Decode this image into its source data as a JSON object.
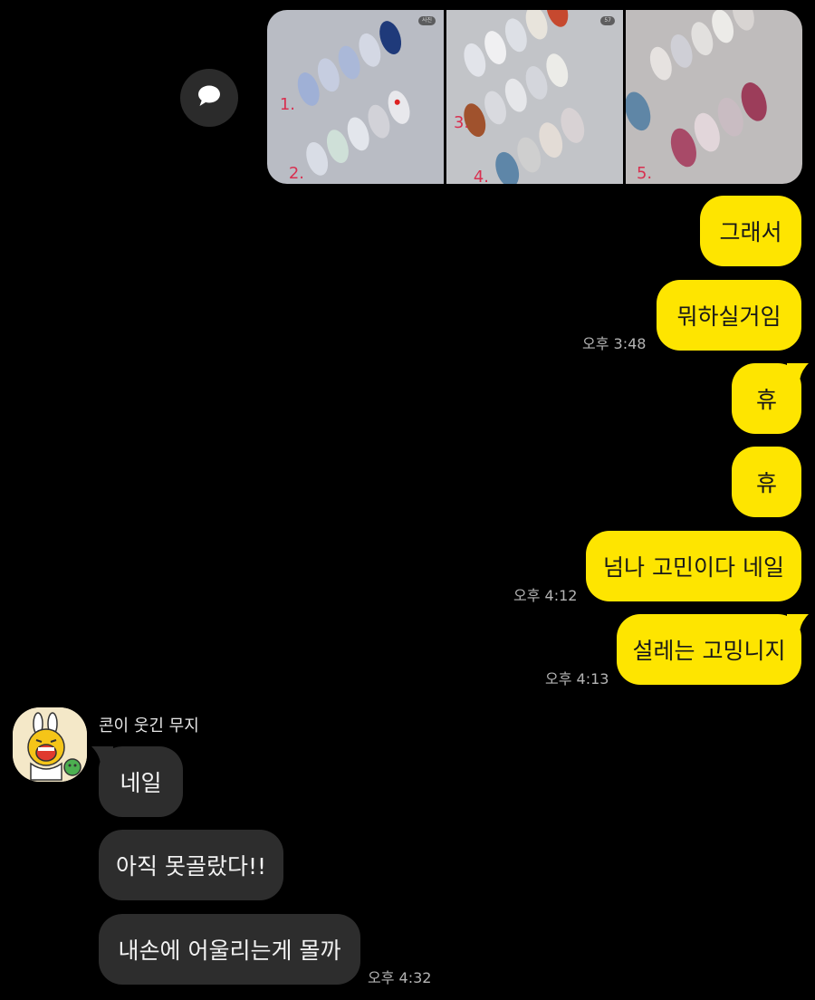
{
  "colors": {
    "background": "#000000",
    "my_bubble": "#fee500",
    "their_bubble": "#2d2d2d",
    "timestamp": "#b4b4b4"
  },
  "share_button": {
    "icon": "speech-bubble-icon"
  },
  "image_strip": {
    "thumbnails": [
      {
        "name": "nail-design-photo-1",
        "badge": "사진"
      },
      {
        "name": "nail-design-photo-2",
        "badge": "57"
      },
      {
        "name": "nail-design-photo-3",
        "badge": ""
      }
    ]
  },
  "messages": {
    "m1": "그래서",
    "m2": "뭐하실거임",
    "m2_time": "오후 3:48",
    "m3": "휴",
    "m4": "휴",
    "m5": "넘나 고민이다 네일",
    "m5_time": "오후 4:12",
    "m6": "설레는 고밍니지",
    "m6_time": "오후 4:13",
    "sender_name": "콘이 웃긴 무지",
    "r1": "네일",
    "r2": "아직 못골랐다!!",
    "r3": "내손에 어울리는게 몰까",
    "r3_time": "오후 4:32"
  }
}
